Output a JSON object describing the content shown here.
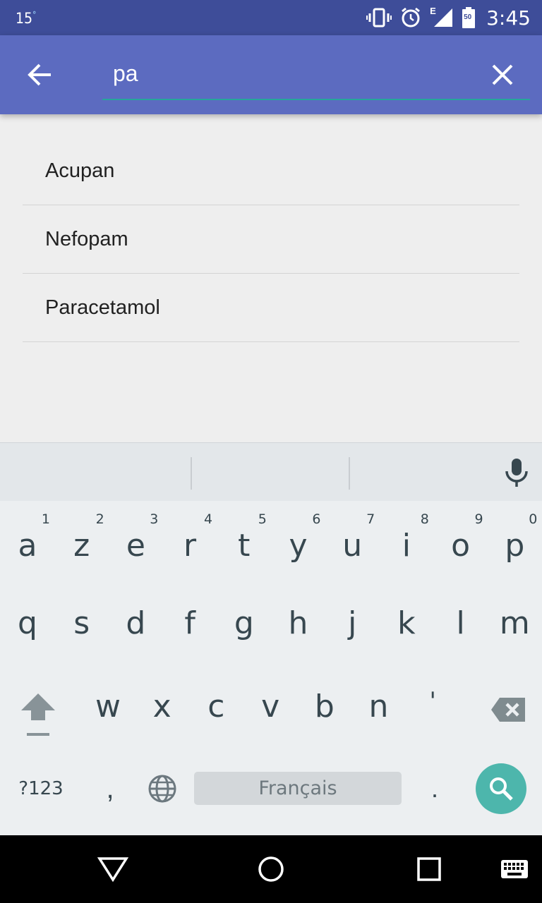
{
  "status_bar": {
    "temperature": "15",
    "degree": "°",
    "network": "E",
    "battery_level": "50",
    "time": "3:45"
  },
  "search": {
    "value": "pa",
    "back_icon": "arrow-left-icon",
    "clear_icon": "close-icon",
    "underline_color": "#26a69a"
  },
  "results": [
    {
      "label": "Acupan"
    },
    {
      "label": "Nefopam"
    },
    {
      "label": "Paracetamol"
    }
  ],
  "keyboard": {
    "row1": [
      {
        "letter": "a",
        "hint": "1"
      },
      {
        "letter": "z",
        "hint": "2"
      },
      {
        "letter": "e",
        "hint": "3"
      },
      {
        "letter": "r",
        "hint": "4"
      },
      {
        "letter": "t",
        "hint": "5"
      },
      {
        "letter": "y",
        "hint": "6"
      },
      {
        "letter": "u",
        "hint": "7"
      },
      {
        "letter": "i",
        "hint": "8"
      },
      {
        "letter": "o",
        "hint": "9"
      },
      {
        "letter": "p",
        "hint": "0"
      }
    ],
    "row2": [
      "q",
      "s",
      "d",
      "f",
      "g",
      "h",
      "j",
      "k",
      "l",
      "m"
    ],
    "row3": [
      "w",
      "x",
      "c",
      "v",
      "b",
      "n",
      "'"
    ],
    "symbols_label": "?123",
    "comma_label": ",",
    "space_label": "Français",
    "period_label": ".",
    "accent_color": "#4db6ac"
  }
}
